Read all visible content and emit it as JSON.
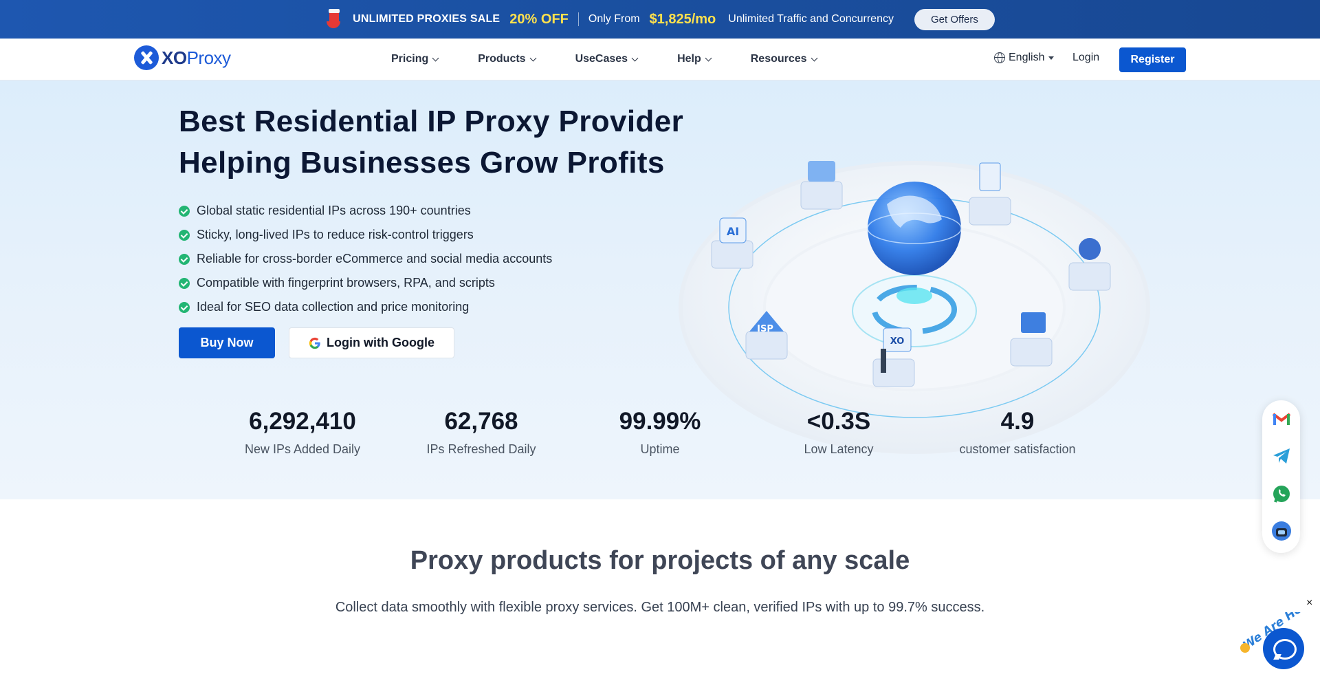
{
  "promo": {
    "sale": "UNLIMITED PROXIES SALE",
    "discount": "20% OFF",
    "from": "Only From",
    "price": "$1,825/mo",
    "traffic": "Unlimited Traffic and Concurrency",
    "button": "Get Offers"
  },
  "nav": {
    "brand_strong": "XO",
    "brand_light": "Proxy",
    "menu": [
      "Pricing",
      "Products",
      "UseCases",
      "Help",
      "Resources"
    ],
    "language": "English",
    "login": "Login",
    "register": "Register"
  },
  "hero": {
    "title_line1": "Best Residential IP Proxy Provider",
    "title_line2": "Helping Businesses Grow Profits",
    "features": [
      "Global static residential IPs across 190+ countries",
      "Sticky, long-lived IPs to reduce risk-control triggers",
      "Reliable for cross-border eCommerce and social media accounts",
      "Compatible with fingerprint browsers, RPA, and scripts",
      "Ideal for SEO data collection and price monitoring"
    ],
    "buy_button": "Buy Now",
    "google_button": "Login with Google",
    "illustration_labels": {
      "ai": "AI",
      "isp": "ISP",
      "xo": "XO"
    }
  },
  "stats": [
    {
      "value": "6,292,410",
      "label": "New IPs Added Daily"
    },
    {
      "value": "62,768",
      "label": "IPs Refreshed Daily"
    },
    {
      "value": "99.99%",
      "label": "Uptime"
    },
    {
      "value": "<0.3S",
      "label": "Low Latency"
    },
    {
      "value": "4.9",
      "label": "customer satisfaction"
    }
  ],
  "products": {
    "title": "Proxy products for projects of any scale",
    "subtitle": "Collect data smoothly with flexible proxy services. Get 100M+ clean, verified IPs with up to 99.7% success."
  },
  "contact_bar": {
    "icons": [
      "gmail-icon",
      "telegram-icon",
      "whatsapp-icon",
      "support-agent-icon"
    ]
  },
  "chat": {
    "tagline": "We Are Here!",
    "close": "×"
  },
  "colors": {
    "primary": "#0b57d0",
    "promo_bg": "#1a4f9f",
    "accent_yellow": "#ffe14d",
    "check_green": "#22b573",
    "hero_bg": "#dcedfb"
  }
}
